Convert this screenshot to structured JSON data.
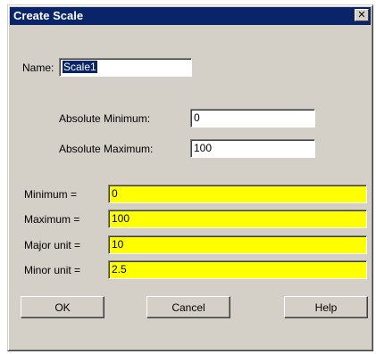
{
  "window": {
    "title": "Create Scale",
    "close_glyph": "✕"
  },
  "name_field": {
    "label": "Name:",
    "value": "Scale1"
  },
  "absolute_min": {
    "label": "Absolute Minimum:",
    "value": "0"
  },
  "absolute_max": {
    "label": "Absolute Maximum:",
    "value": "100"
  },
  "minimum": {
    "label": "Minimum =",
    "value": "0"
  },
  "maximum": {
    "label": "Maximum =",
    "value": "100"
  },
  "major_unit": {
    "label": "Major unit =",
    "value": "10"
  },
  "minor_unit": {
    "label": "Minor unit =",
    "value": "2.5"
  },
  "buttons": {
    "ok": "OK",
    "cancel": "Cancel",
    "help": "Help"
  },
  "colors": {
    "highlight_field": "#ffff00",
    "titlebar": "#0a246a",
    "dialog_bg": "#d4d0c8"
  }
}
